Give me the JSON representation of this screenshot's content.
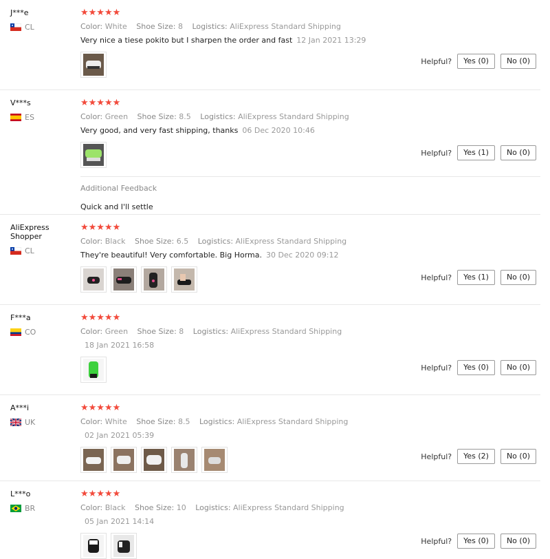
{
  "helpful_label": "Helpful?",
  "labels": {
    "color": "Color:",
    "size": "Shoe Size:",
    "logistics": "Logistics:"
  },
  "reviews": [
    {
      "user": "J***e",
      "country": "CL",
      "stars": "★★★★★",
      "color": "White",
      "size": "8",
      "logistics": "AliExpress Standard Shipping",
      "text": "Very nice a tiese pokito but I sharpen the order and fast",
      "date": "12 Jan 2021 13:29",
      "yes": "Yes (0)",
      "no": "No (0)"
    },
    {
      "user": "V***s",
      "country": "ES",
      "stars": "★★★★★",
      "color": "Green",
      "size": "8.5",
      "logistics": "AliExpress Standard Shipping",
      "text": "Very good, and very fast shipping, thanks",
      "date": "06 Dec 2020 10:46",
      "yes": "Yes (1)",
      "no": "No (0)",
      "additional_title": "Additional Feedback",
      "additional_text": "Quick and I'll settle"
    },
    {
      "user": "AliExpress Shopper",
      "country": "CL",
      "stars": "★★★★★",
      "color": "Black",
      "size": "6.5",
      "logistics": "AliExpress Standard Shipping",
      "text": "They're beautiful! Very comfortable. Big Horma.",
      "date": "30 Dec 2020 09:12",
      "yes": "Yes (1)",
      "no": "No (0)"
    },
    {
      "user": "F***a",
      "country": "CO",
      "stars": "★★★★★",
      "color": "Green",
      "size": "8",
      "logistics": "AliExpress Standard Shipping",
      "text": "",
      "date": "18 Jan 2021 16:58",
      "yes": "Yes (0)",
      "no": "No (0)"
    },
    {
      "user": "A***i",
      "country": "UK",
      "stars": "★★★★★",
      "color": "White",
      "size": "8.5",
      "logistics": "AliExpress Standard Shipping",
      "text": "",
      "date": "02 Jan 2021 05:39",
      "yes": "Yes (2)",
      "no": "No (0)"
    },
    {
      "user": "L***o",
      "country": "BR",
      "stars": "★★★★★",
      "color": "Black",
      "size": "10",
      "logistics": "AliExpress Standard Shipping",
      "text": "",
      "date": "05 Jan 2021 14:14",
      "yes": "Yes (0)",
      "no": "No (0)"
    }
  ],
  "colors": {
    "star": "#f24a3b",
    "border": "#e8e8e8",
    "muted": "#999999"
  }
}
